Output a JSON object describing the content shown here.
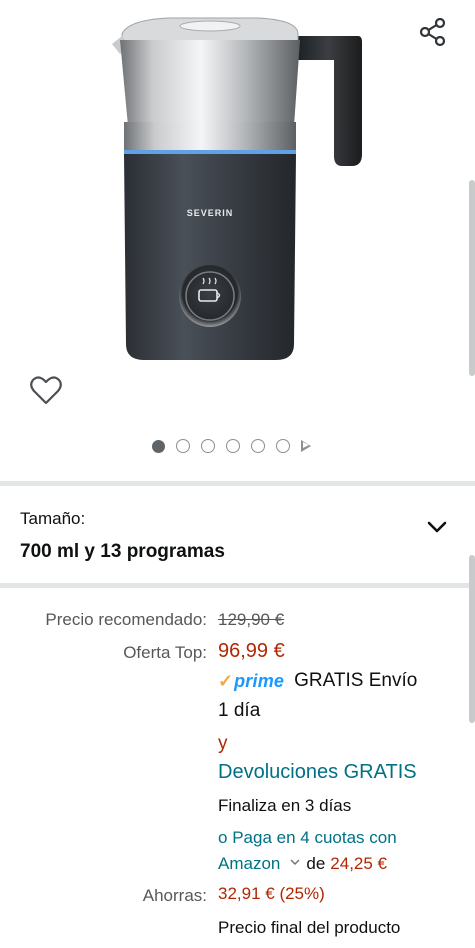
{
  "product": {
    "brand_text": "SEVERIN",
    "carousel": {
      "total_images": 6,
      "active_index": 0
    }
  },
  "icons": {
    "share": "share-icon",
    "favorite": "heart-icon",
    "dropdown": "chevron-down-icon",
    "carousel_next": "play-triangle-icon"
  },
  "size": {
    "label": "Tamaño:",
    "value": "700 ml y 13 programas"
  },
  "pricing": {
    "recommended_label": "Precio recomendado:",
    "recommended_value": "129,90 €",
    "offer_label": "Oferta Top:",
    "offer_value": "96,99 €",
    "prime_check": "✓",
    "prime_word": "prime",
    "shipping_line1": "GRATIS Envío",
    "shipping_line2": "1 día",
    "and_text": "y",
    "returns_text": "Devoluciones GRATIS",
    "finishes_text": "Finaliza en 3 días",
    "installments_prefix": "o",
    "installments_link_line1": "Paga en 4 cuotas con",
    "installments_link_line2": "Amazon",
    "installments_of": "de",
    "installments_amount": "24,25 €",
    "savings_label": "Ahorras:",
    "savings_value": "32,91 € (25%)",
    "final_price_text": "Precio final del producto"
  },
  "colors": {
    "price_red": "#b12704",
    "link_teal": "#007185",
    "prime_blue": "#1a98ff",
    "prime_check_orange": "#f3a847",
    "divider_gray": "#e3e6e6"
  }
}
